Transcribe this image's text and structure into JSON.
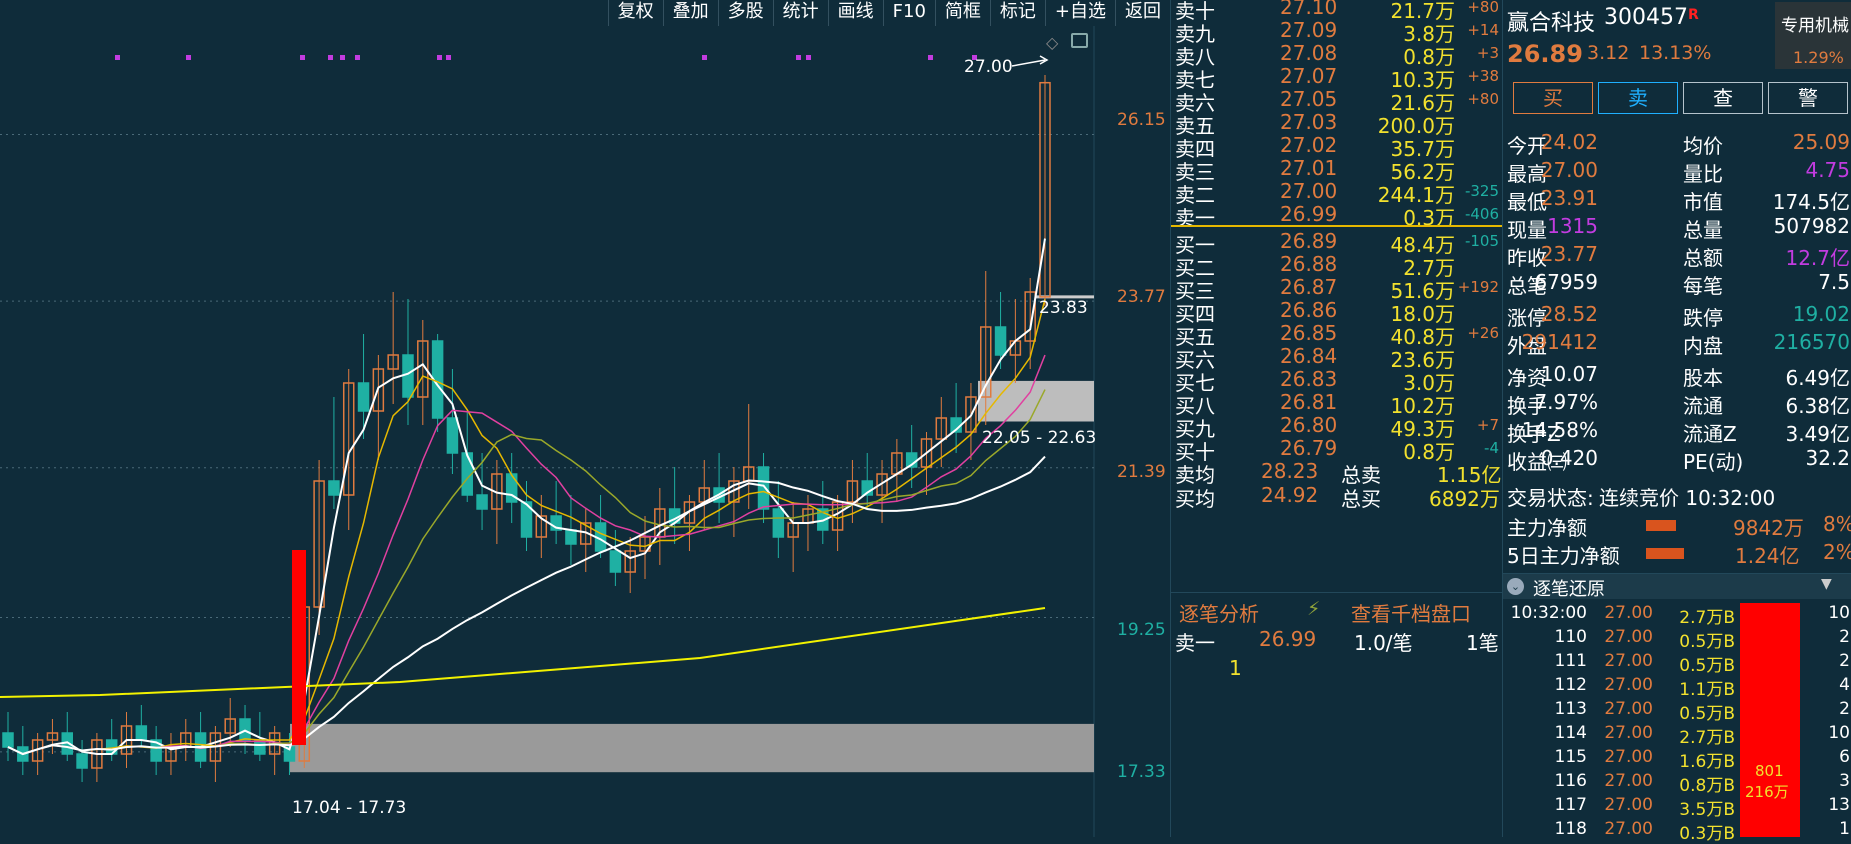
{
  "colors": {
    "up": "#e07b3f",
    "down": "#1fb0a3",
    "yellow": "#f2e12e",
    "purple": "#c23ce0",
    "bg": "#0f2c3a",
    "red": "#ff0000"
  },
  "toolbar": [
    "复权",
    "叠加",
    "多股",
    "统计",
    "画线",
    "F10",
    "简框",
    "标记",
    "+自选",
    "返回"
  ],
  "chart": {
    "price_labels": [
      "26.15",
      "23.77",
      "21.39",
      "19.25",
      "17.33"
    ],
    "high_label": "27.00",
    "last_label": "23.83",
    "zone_high": "22.05 - 22.63",
    "zone_low": "17.04 - 17.73"
  },
  "chart_data": {
    "type": "candlestick",
    "ylim": [
      16.5,
      27.5
    ],
    "candles": [
      [
        17.6,
        17.9,
        17.2,
        17.4
      ],
      [
        17.4,
        17.7,
        17.0,
        17.2
      ],
      [
        17.2,
        17.6,
        17.0,
        17.5
      ],
      [
        17.5,
        17.8,
        17.3,
        17.6
      ],
      [
        17.6,
        17.9,
        17.2,
        17.3
      ],
      [
        17.3,
        17.5,
        16.9,
        17.1
      ],
      [
        17.1,
        17.6,
        16.9,
        17.5
      ],
      [
        17.5,
        17.8,
        17.2,
        17.3
      ],
      [
        17.3,
        17.9,
        17.1,
        17.7
      ],
      [
        17.7,
        18.0,
        17.4,
        17.5
      ],
      [
        17.5,
        17.7,
        17.0,
        17.2
      ],
      [
        17.2,
        17.6,
        17.0,
        17.4
      ],
      [
        17.4,
        17.8,
        17.2,
        17.6
      ],
      [
        17.6,
        17.9,
        17.1,
        17.2
      ],
      [
        17.2,
        17.7,
        16.9,
        17.6
      ],
      [
        17.6,
        18.1,
        17.4,
        17.8
      ],
      [
        17.8,
        18.0,
        17.3,
        17.5
      ],
      [
        17.5,
        17.9,
        17.2,
        17.3
      ],
      [
        17.3,
        17.7,
        17.0,
        17.6
      ],
      [
        17.4,
        17.6,
        17.0,
        17.2
      ],
      [
        17.2,
        19.5,
        17.1,
        19.4
      ],
      [
        19.4,
        21.5,
        19.0,
        21.2
      ],
      [
        21.2,
        22.4,
        20.8,
        21.0
      ],
      [
        21.0,
        22.8,
        20.5,
        22.6
      ],
      [
        22.6,
        23.3,
        21.8,
        22.2
      ],
      [
        22.2,
        23.0,
        21.5,
        22.8
      ],
      [
        22.8,
        23.9,
        22.3,
        23.0
      ],
      [
        23.0,
        23.8,
        22.0,
        22.4
      ],
      [
        22.4,
        23.5,
        22.0,
        23.2
      ],
      [
        23.2,
        23.3,
        21.9,
        22.1
      ],
      [
        22.1,
        22.8,
        21.3,
        21.6
      ],
      [
        21.6,
        22.2,
        20.9,
        21.0
      ],
      [
        21.0,
        21.6,
        20.5,
        20.8
      ],
      [
        20.8,
        21.5,
        20.3,
        21.3
      ],
      [
        21.3,
        21.6,
        20.6,
        20.9
      ],
      [
        20.9,
        21.2,
        20.2,
        20.4
      ],
      [
        20.4,
        21.0,
        20.1,
        20.7
      ],
      [
        20.7,
        21.2,
        20.3,
        20.5
      ],
      [
        20.5,
        21.0,
        20.0,
        20.3
      ],
      [
        20.3,
        20.8,
        19.9,
        20.6
      ],
      [
        20.6,
        21.0,
        20.1,
        20.2
      ],
      [
        20.2,
        20.5,
        19.7,
        19.9
      ],
      [
        19.9,
        20.4,
        19.6,
        20.2
      ],
      [
        20.2,
        20.7,
        19.8,
        20.4
      ],
      [
        20.4,
        21.1,
        20.0,
        20.8
      ],
      [
        20.8,
        21.4,
        20.3,
        20.6
      ],
      [
        20.6,
        21.0,
        20.2,
        20.9
      ],
      [
        20.9,
        21.5,
        20.5,
        21.1
      ],
      [
        21.1,
        21.6,
        20.6,
        20.9
      ],
      [
        20.9,
        21.4,
        20.4,
        21.2
      ],
      [
        21.2,
        22.3,
        20.8,
        21.4
      ],
      [
        21.4,
        21.6,
        20.6,
        20.8
      ],
      [
        20.8,
        21.2,
        20.1,
        20.4
      ],
      [
        20.4,
        20.9,
        19.9,
        20.6
      ],
      [
        20.6,
        21.0,
        20.2,
        20.8
      ],
      [
        20.8,
        21.2,
        20.3,
        20.5
      ],
      [
        20.5,
        21.0,
        20.2,
        20.9
      ],
      [
        20.9,
        21.5,
        20.6,
        21.2
      ],
      [
        21.2,
        21.6,
        20.8,
        21.0
      ],
      [
        21.0,
        21.5,
        20.6,
        21.3
      ],
      [
        21.3,
        21.8,
        20.9,
        21.6
      ],
      [
        21.6,
        22.0,
        21.1,
        21.4
      ],
      [
        21.4,
        21.9,
        21.0,
        21.8
      ],
      [
        21.8,
        22.4,
        21.4,
        22.1
      ],
      [
        22.1,
        22.6,
        21.6,
        21.9
      ],
      [
        21.9,
        22.6,
        21.5,
        22.4
      ],
      [
        22.4,
        24.2,
        22.0,
        23.4
      ],
      [
        23.4,
        23.9,
        22.8,
        23.0
      ],
      [
        23.0,
        23.8,
        22.6,
        23.2
      ],
      [
        23.2,
        24.1,
        22.8,
        23.9
      ],
      [
        23.83,
        27.0,
        23.7,
        26.89
      ]
    ]
  },
  "depth": {
    "asks": [
      [
        "卖十",
        "27.10",
        "21.7万",
        "+80"
      ],
      [
        "卖九",
        "27.09",
        "3.8万",
        "+14"
      ],
      [
        "卖八",
        "27.08",
        "0.8万",
        "+3"
      ],
      [
        "卖七",
        "27.07",
        "10.3万",
        "+38"
      ],
      [
        "卖六",
        "27.05",
        "21.6万",
        "+80"
      ],
      [
        "卖五",
        "27.03",
        "200.0万",
        ""
      ],
      [
        "卖四",
        "27.02",
        "35.7万",
        ""
      ],
      [
        "卖三",
        "27.01",
        "56.2万",
        ""
      ],
      [
        "卖二",
        "27.00",
        "244.1万",
        "-325"
      ],
      [
        "卖一",
        "26.99",
        "0.3万",
        "-406"
      ]
    ],
    "bids": [
      [
        "买一",
        "26.89",
        "48.4万",
        "-105"
      ],
      [
        "买二",
        "26.88",
        "2.7万",
        ""
      ],
      [
        "买三",
        "26.87",
        "51.6万",
        "+192"
      ],
      [
        "买四",
        "26.86",
        "18.0万",
        ""
      ],
      [
        "买五",
        "26.85",
        "40.8万",
        "+26"
      ],
      [
        "买六",
        "26.84",
        "23.6万",
        ""
      ],
      [
        "买七",
        "26.83",
        "3.0万",
        ""
      ],
      [
        "买八",
        "26.81",
        "10.2万",
        ""
      ],
      [
        "买九",
        "26.80",
        "49.3万",
        "+7"
      ],
      [
        "买十",
        "26.79",
        "0.8万",
        "-4"
      ]
    ],
    "ask_avg_label": "卖均",
    "ask_avg": "28.23",
    "total_sell_label": "总卖",
    "total_sell": "1.15亿",
    "bid_avg_label": "买均",
    "bid_avg": "24.92",
    "total_buy_label": "总买",
    "total_buy": "6892万",
    "tab_trade": "逐笔分析",
    "tab_depth": "查看千档盘口",
    "tick_label": "卖一",
    "tick_price": "26.99",
    "tick_vol": "1.0/笔",
    "tick_count": "1笔",
    "tick_index": "1"
  },
  "stock": {
    "name": "赢合科技",
    "code": "300457",
    "tag": "R",
    "price": "26.89",
    "change": "3.12",
    "pct": "13.13%",
    "sector": "专用机械",
    "sector_pct": "1.29%",
    "buttons": [
      "买",
      "卖",
      "查",
      "警"
    ],
    "stats": [
      [
        "今开",
        "24.02",
        "均价",
        "25.09"
      ],
      [
        "最高",
        "27.00",
        "量比",
        "4.75"
      ],
      [
        "最低",
        "23.91",
        "市值",
        "174.5亿"
      ],
      [
        "现量",
        "1315",
        "总量",
        "507982"
      ],
      [
        "昨收",
        "23.77",
        "总额",
        "12.7亿"
      ],
      [
        "总笔",
        "67959",
        "每笔",
        "7.5"
      ],
      [
        "涨停",
        "28.52",
        "跌停",
        "19.02"
      ],
      [
        "外盘",
        "291412",
        "内盘",
        "216570"
      ],
      [
        "净资",
        "10.07",
        "股本",
        "6.49亿"
      ],
      [
        "换手",
        "7.97%",
        "流通",
        "6.38亿"
      ],
      [
        "换手Z",
        "14.58%",
        "流通Z",
        "3.49亿"
      ],
      [
        "收益㈢",
        "0.420",
        "PE(动)",
        "32.2"
      ]
    ],
    "status_label": "交易状态:",
    "status": "连续竞价 10:32:00",
    "flow1_label": "主力净额",
    "flow1": "9842万",
    "flow1_pct": "8%",
    "flow2_label": "5日主力净额",
    "flow2": "1.24亿",
    "flow2_pct": "2%",
    "ticks_title": "逐笔还原",
    "ticks": [
      [
        "10:32:00",
        "27.00",
        "2.7万B",
        "10"
      ],
      [
        "110",
        "27.00",
        "0.5万B",
        "2"
      ],
      [
        "111",
        "27.00",
        "0.5万B",
        "2"
      ],
      [
        "112",
        "27.00",
        "1.1万B",
        "4"
      ],
      [
        "113",
        "27.00",
        "0.5万B",
        "2"
      ],
      [
        "114",
        "27.00",
        "2.7万B",
        "10"
      ],
      [
        "115",
        "27.00",
        "1.6万B",
        "6"
      ],
      [
        "116",
        "27.00",
        "0.8万B",
        "3"
      ],
      [
        "117",
        "27.00",
        "3.5万B",
        "13"
      ],
      [
        "118",
        "27.00",
        "0.3万B",
        "1"
      ]
    ],
    "big_order": "801",
    "big_order_vol": "216万"
  }
}
